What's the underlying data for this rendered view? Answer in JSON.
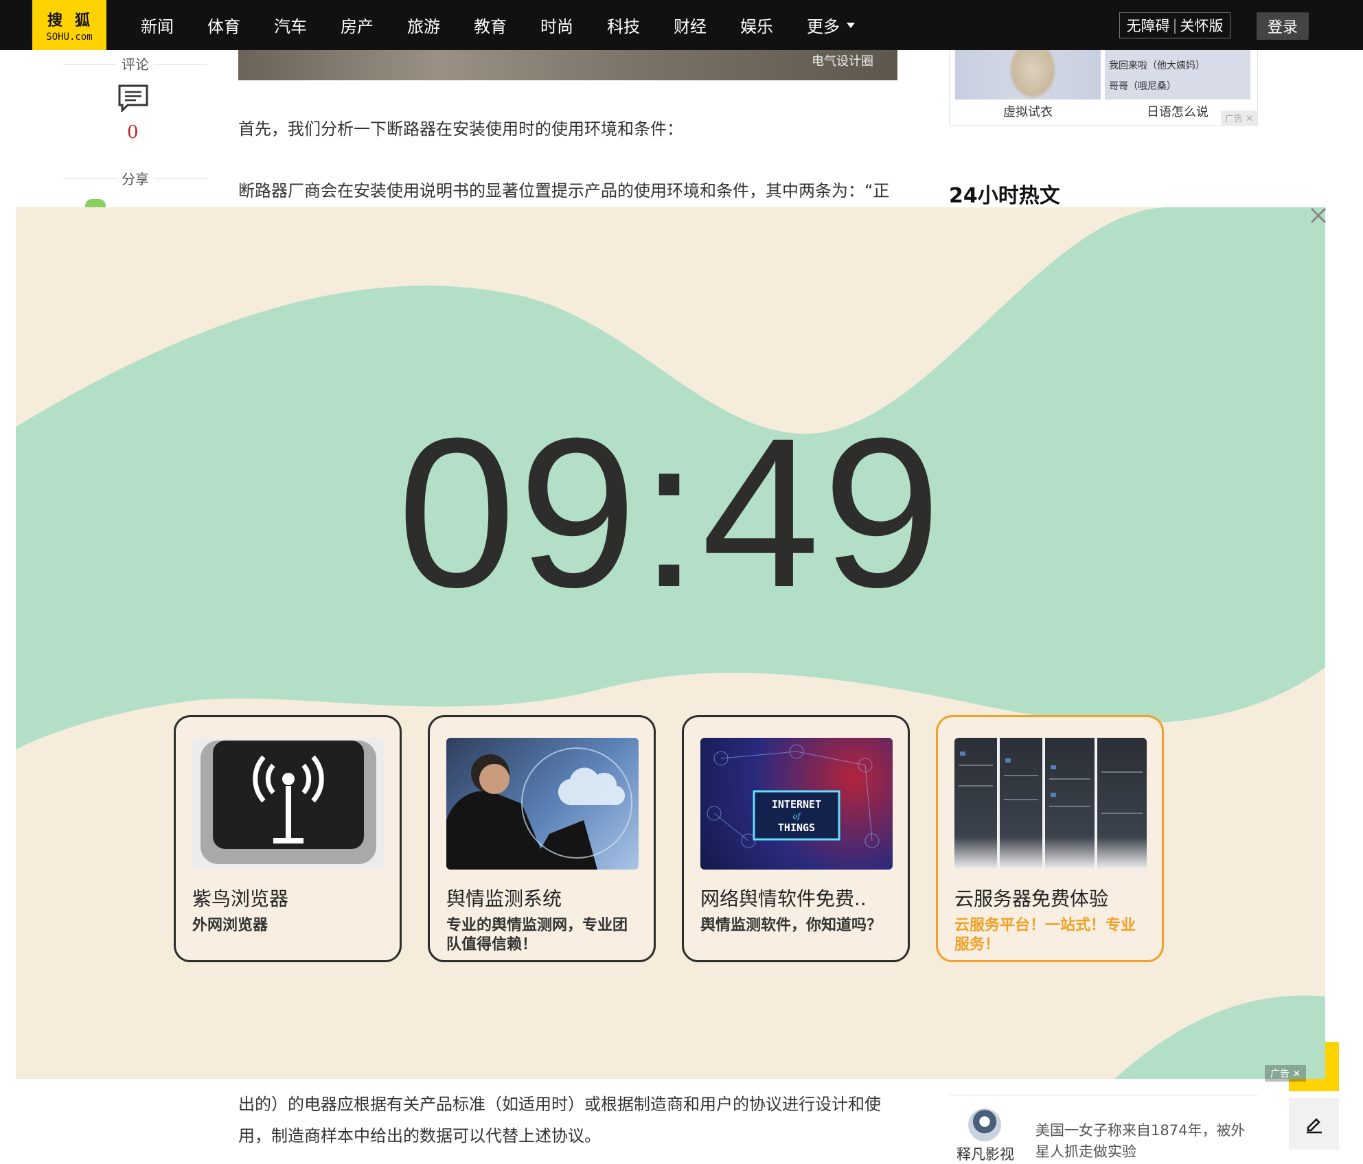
{
  "logo": {
    "cn": "搜狐",
    "en": "SOHU.com"
  },
  "nav": {
    "items": [
      "新闻",
      "体育",
      "汽车",
      "房产",
      "旅游",
      "教育",
      "时尚",
      "科技",
      "财经",
      "娱乐"
    ],
    "more": "更多",
    "accessibility": "无障碍",
    "elder": "关怀版",
    "login": "登录"
  },
  "sidebar": {
    "comment_label": "评论",
    "comment_count": "0",
    "share_label": "分享"
  },
  "article": {
    "image_caption": "电气设计圈",
    "para1": "首先，我们分析一下断路器在安装使用时的使用环境和条件：",
    "para2": "断路器厂商会在安装使用说明书的显著位置提示产品的使用环境和条件，其中两条为：“正",
    "para3": "出的）的电器应根据有关产品标准（如适用时）或根据制造商和用户的协议进行设计和使",
    "para4": "用，制造商样本中给出的数据可以代替上述协议。"
  },
  "right_ad": {
    "item1": "虚拟试衣",
    "item2": "日语怎么说",
    "item2_line1": "我回来啦（他大姨妈）",
    "item2_line2": "哥哥（哦尼桑）",
    "ad_tag": "广告"
  },
  "hot": {
    "title": "24小时热文",
    "author": "释凡影视",
    "text": "美国一女子称来自1874年，被外星人抓走做实验"
  },
  "overlay": {
    "clock": "09:49",
    "ad_tag": "广告",
    "cards": [
      {
        "title": "紫鸟浏览器",
        "desc": "外网浏览器"
      },
      {
        "title": "舆情监测系统",
        "desc": "专业的舆情监测网，专业团队值得信赖！"
      },
      {
        "title": "网络舆情软件免费..",
        "desc": "舆情监测软件，你知道吗？",
        "thumb_text1": "INTERNET",
        "thumb_text2": "of",
        "thumb_text3": "THINGS"
      },
      {
        "title": "云服务器免费体验",
        "desc": "云服务平台！一站式！专业服务！"
      }
    ],
    "colors": {
      "mint": "#b4dfc7",
      "cream": "#f5ecdc",
      "highlight": "#f0a128"
    }
  }
}
